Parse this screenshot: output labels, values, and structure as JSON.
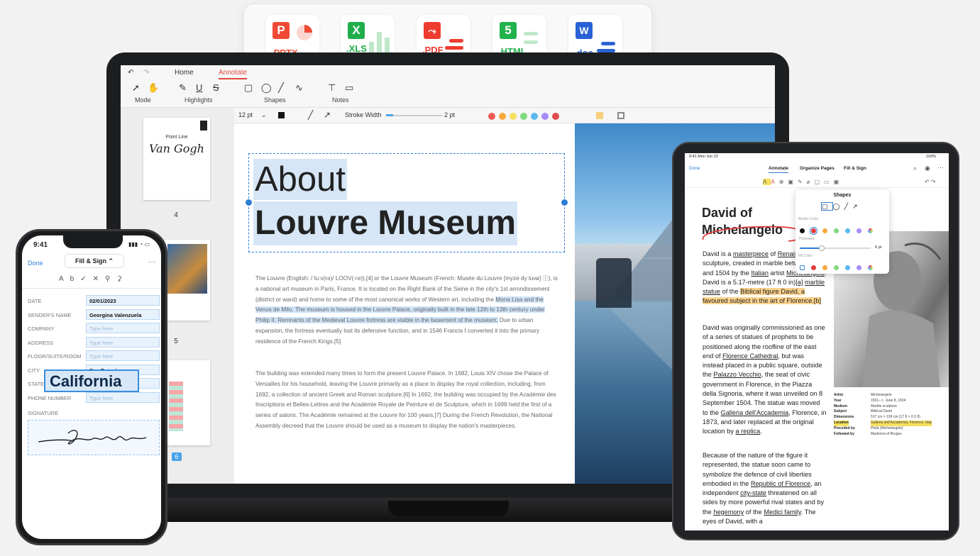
{
  "formats": [
    {
      "label": ".PPTX",
      "glyph": "P",
      "color": "#f04a36"
    },
    {
      "label": ".XLS",
      "glyph": "X",
      "color": "#1fae4b"
    },
    {
      "label": ".PDF",
      "glyph": "⤳",
      "color": "#ee3b2f"
    },
    {
      "label": ".HTML",
      "glyph": "5",
      "color": "#22b24c"
    },
    {
      "label": ".doc",
      "glyph": "W",
      "color": "#2862d6"
    }
  ],
  "laptop": {
    "tabs": [
      "Home",
      "Annotate"
    ],
    "groups": [
      "Mode",
      "Highlights",
      "Shapes",
      "Notes"
    ],
    "font_size": "12 pt",
    "stroke_label": "Stroke Width",
    "stroke_value": "2 pt",
    "palette": [
      "#f25c54",
      "#f7a93b",
      "#f6e05e",
      "#7fd97f",
      "#5ab9f0",
      "#a78bfa",
      "#e14b4b"
    ],
    "thumbnails": [
      {
        "number": "4",
        "tag": "Van Gogh",
        "subtitle": "Point Line"
      },
      {
        "number": "5"
      },
      {
        "number": "6"
      }
    ],
    "title_line1": "About",
    "title_line2": "Louvre Museum",
    "para1_a": "The Louvre (English: /ˈluːv(rə)/ LOOV(-rə)),[4] or the Louvre Museum (French: Musée du Louvre [myze dy luvʁ] ⓘ), is a national art museum in Paris, France. It is located on the Right Bank of the Seine in the city's 1st arrondissement (district or ward) and home to some of the most canonical works of Western art, including the ",
    "para1_hl": "Mona Lisa and the Venus de Milo. The museum is housed in the Louvre Palace, originally built in the late 12th to 13th century under Philip II. Remnants of the Medieval Louvre fortress are visible in the basement of the museum.",
    "para1_b": " Due to urban expansion, the fortress eventually lost its defensive function, and in 1546 Francis I converted it into the primary residence of the French Kings.[5]",
    "para2": "The building was extended many times to form the present Louvre Palace. In 1682, Louis XIV chose the Palace of Versailles for his household, leaving the Louvre primarily as a place to display the royal collection, including, from 1692, a collection of ancient Greek and Roman sculpture.[6] In 1692, the building was occupied by the Académie des Inscriptions et Belles-Lettres and the Académie Royale de Peinture et de Sculpture, which in 1699 held the first of a series of salons. The Académie remained at the Louvre for 100 years.[7] During the French Revolution, the National Assembly decreed that the Louvre should be used as a museum to display the nation's masterpieces."
  },
  "phone": {
    "time": "9:41",
    "done": "Done",
    "mode": "Fill & Sign",
    "more": "···",
    "fields": [
      {
        "label": "DATE",
        "value": "02/01/2023",
        "placeholder": ""
      },
      {
        "label": "SENDER'S NAME",
        "value": "Georgina Valenzuela",
        "placeholder": ""
      },
      {
        "label": "COMPANY",
        "value": "",
        "placeholder": "Type here"
      },
      {
        "label": "ADDRESS",
        "value": "",
        "placeholder": "Type here"
      },
      {
        "label": "FLOOR/SUITE/ROOM",
        "value": "",
        "placeholder": "Type here"
      },
      {
        "label": "CITY",
        "value": "San Francisco",
        "placeholder": ""
      },
      {
        "label": "STATE",
        "value": "",
        "placeholder": ""
      },
      {
        "label": "PHONE NUMBER",
        "value": "",
        "placeholder": "Type here"
      }
    ],
    "signature_label": "SIGNATURE",
    "state_overlay": "California"
  },
  "tablet": {
    "time": "9:41  Mon Jun 22",
    "battery": "100%",
    "done": "Done",
    "tabs": [
      "Annotate",
      "Organize Pages",
      "Fill & Sign"
    ],
    "shapes_title": "Shapes",
    "border_color": "Border Color",
    "thickness": "Thickness",
    "thickness_value": "6 pt",
    "fill_color": "Fill Color",
    "heading1": "David of",
    "heading2": "Michelangelo",
    "p1": [
      {
        "t": "David is a "
      },
      {
        "t": "masterpiece",
        "s": "u"
      },
      {
        "t": " of "
      },
      {
        "t": "Renaissance",
        "s": "u"
      },
      {
        "t": " sculpture, created in marble between 1501 and 1504 by the "
      },
      {
        "t": "Italian",
        "s": "u"
      },
      {
        "t": " artist "
      },
      {
        "t": "Michelangelo",
        "s": "u"
      },
      {
        "t": ". David is a 5.17-metre (17 ft 0 in)"
      },
      {
        "t": "[a]",
        "s": "u"
      },
      {
        "t": " "
      },
      {
        "t": "marble statue",
        "s": "u"
      },
      {
        "t": " of the "
      },
      {
        "t": "Biblical figure David",
        "s": "org"
      },
      {
        "t": ", a favoured subject in the art of ",
        "s": "org"
      },
      {
        "t": "Florence",
        "s": "org"
      },
      {
        "t": ".[b]",
        "s": "org"
      }
    ],
    "p2": [
      {
        "t": "David was originally commissioned as one of a series of statues of prophets to be positioned along the roofline of the east end of "
      },
      {
        "t": "Florence Cathedral",
        "s": "u"
      },
      {
        "t": ", but was instead placed in a public square, outside the "
      },
      {
        "t": "Palazzo Vecchio",
        "s": "u"
      },
      {
        "t": ", the seat of civic government in Florence, in the Piazza della Signoria, where it was unveiled on 8 September 1504. The statue was moved to the "
      },
      {
        "t": "Galleria dell'Accademia",
        "s": "u"
      },
      {
        "t": ", Florence, in 1873, and later replaced at the original location by "
      },
      {
        "t": "a replica",
        "s": "u"
      },
      {
        "t": "."
      }
    ],
    "p3": [
      {
        "t": "Because of the nature of the figure it represented, the statue soon came to symbolize the defence of civil liberties embodied in the "
      },
      {
        "t": "Republic of Florence",
        "s": "u"
      },
      {
        "t": ", an independent "
      },
      {
        "t": "city-state",
        "s": "u"
      },
      {
        "t": " threatened on all sides by more powerful rival states and by the "
      },
      {
        "t": "hegemony",
        "s": "u"
      },
      {
        "t": " of the "
      },
      {
        "t": "Medici family",
        "s": "u"
      },
      {
        "t": ". The eyes of David, with a"
      }
    ],
    "meta": [
      {
        "k": "Artist",
        "v": "Michelangelo"
      },
      {
        "k": "Year",
        "v": "1501– c. June 8, 1504"
      },
      {
        "k": "Medium",
        "v": "Marble sculpture"
      },
      {
        "k": "Subject",
        "v": "Biblical David"
      },
      {
        "k": "Dimensions",
        "v": "517 cm × 199 cm (17 ft × 6.5 ft)"
      },
      {
        "k": "Location",
        "v": "Galleria dell'Accademia, Florence, Italy"
      },
      {
        "k": "Preceded by",
        "v": "Pietà (Michelangelo)"
      },
      {
        "k": "Followed by",
        "v": "Madonna of Bruges"
      }
    ]
  }
}
